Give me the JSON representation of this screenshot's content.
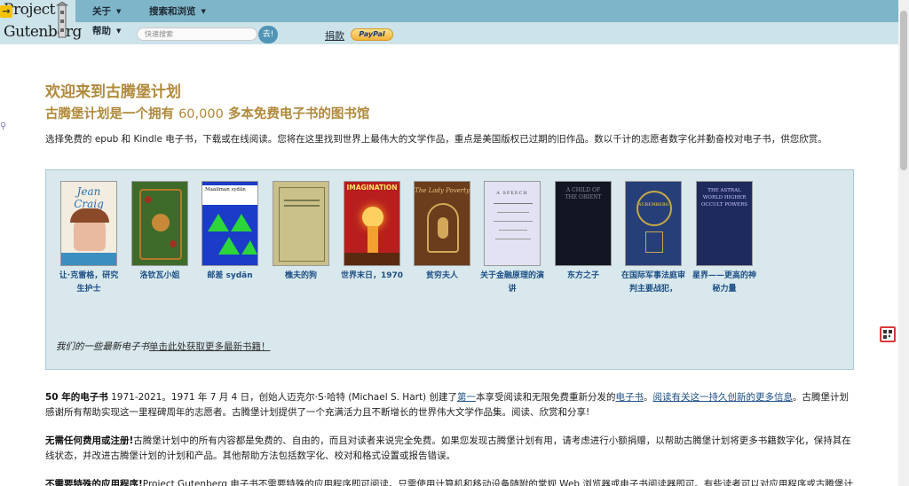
{
  "header": {
    "logo_line1": "Project",
    "logo_line2": "Gutenberg",
    "menu_about": "关于",
    "menu_search_browse": "搜索和浏览",
    "menu_help": "帮助",
    "search_placeholder": "快速搜索",
    "search_button": "去!",
    "donate_link": "捐款",
    "paypal_label": "PayPal"
  },
  "main": {
    "title": "欢迎来到古腾堡计划",
    "subtitle_pre": "古腾堡计划是一个拥有 ",
    "subtitle_num": "60,000",
    "subtitle_post": " 多本免费电子书的图书馆",
    "intro": "选择免费的 epub 和 Kindle 电子书，下载或在线阅读。您将在这里找到世界上最伟大的文学作品，重点是美国版权已过期的旧作品。数以千计的志愿者数字化并勤奋校对电子书，供您欣赏。"
  },
  "books": {
    "items": [
      {
        "label": "让·克雷格，研究生护士",
        "cover_text": "Jean Craig"
      },
      {
        "label": "洛钦瓦小姐",
        "cover_text": ""
      },
      {
        "label": "邮差 sydän",
        "cover_text": "Maailman sydän"
      },
      {
        "label": "樵夫的狗",
        "cover_text": ""
      },
      {
        "label": "世界末日，1970",
        "cover_text": "IMAGINATION"
      },
      {
        "label": "贫穷夫人",
        "cover_text": "The Lady Poverty"
      },
      {
        "label": "关于金融原理的演讲",
        "cover_text": "A SPEECH"
      },
      {
        "label": "东方之子",
        "cover_text": "A CHILD OF THE ORIENT"
      },
      {
        "label": "在国际军事法庭审判主要战犯，",
        "cover_text": "NUREMBERG"
      },
      {
        "label": "星界——更高的神秘力量",
        "cover_text": "THE ASTRAL WORLD HIGHER OCCULT POWERS"
      }
    ],
    "note_text": "我们的一些最新电子书",
    "note_link": "单击此处获取更多最新书籍！"
  },
  "para1": {
    "bold": "50 年的电子书",
    "bold_years": " 1971-2021。",
    "text1": "1971 年 7 月 4 日，创始人迈克尔·S·哈特 (Michael S. Hart) 创建了",
    "link1": "第一",
    "text2": "本享受阅读和无限免费重新分发的",
    "link2": "电子书",
    "text3": "。",
    "link3": "阅读有关这一持久创新的更多信息",
    "text4": "。古腾堡计划感谢所有帮助实现这一里程碑周年的志愿者。古腾堡计划提供了一个充满活力且不断增长的世界伟大文学作品集。阅读、欣赏和分享!"
  },
  "para2": {
    "bold": "无需任何费用或注册!",
    "text": "古腾堡计划中的所有内容都是免费的、自由的，而且对读者来说完全免费。如果您发现古腾堡计划有用，请考虑进行小额捐赠，以帮助古腾堡计划将更多书籍数字化，保持其在线状态，并改进古腾堡计划的计划和产品。其他帮助方法包括数字化、校对和格式设置或报告错误。"
  },
  "para3": {
    "bold": "不需要特殊的应用程序!",
    "text": "Project Gutenberg 电子书不需要特殊的应用程序即可阅读。只需使用计算机和移动设备随附的常规 Web 浏览器或电子书阅读器即可。有些读者可以对应用程序或古腾堡计"
  },
  "colors": {
    "header_top": "#7fb5c8",
    "header_bottom": "#cde3ea",
    "title_gold": "#b0893a",
    "link_blue": "#1d4f86",
    "books_bg": "#d8e8ec"
  }
}
